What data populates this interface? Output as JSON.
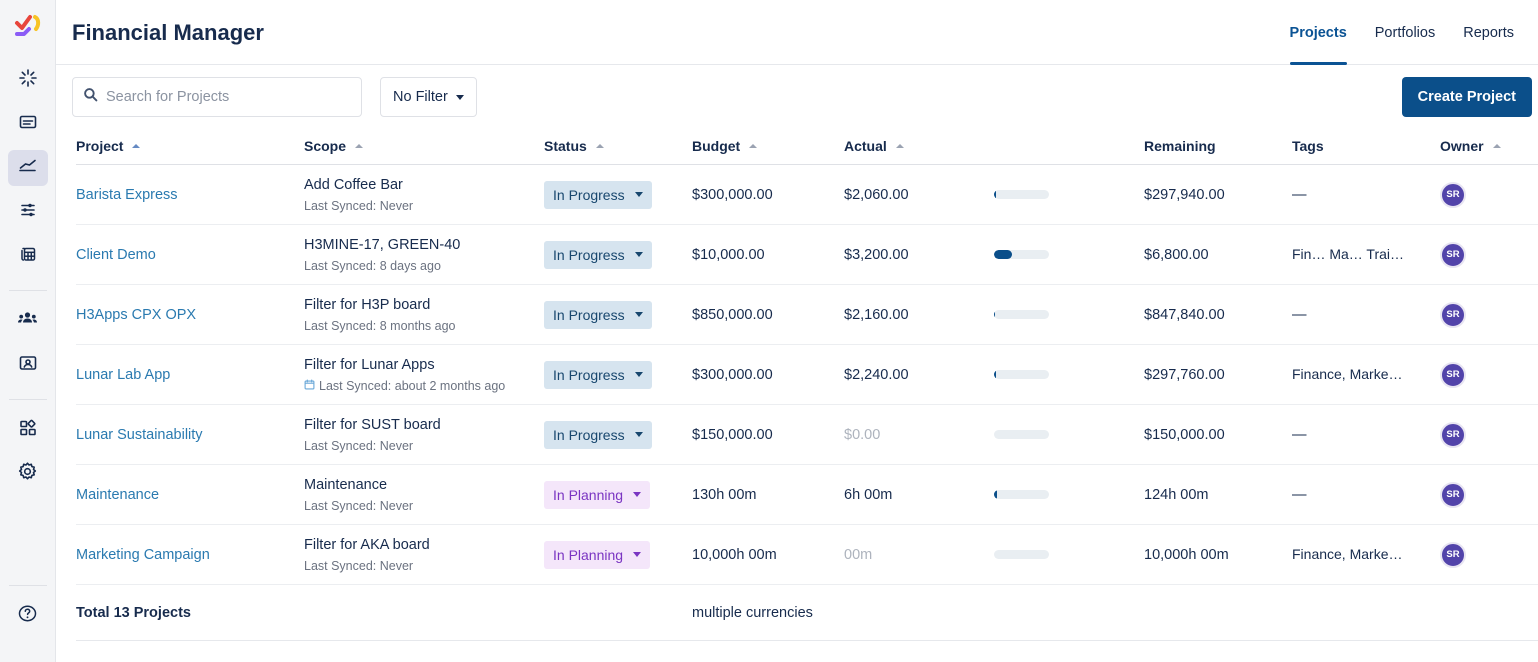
{
  "sidebar": {
    "logo": "app-logo",
    "items": [
      {
        "name": "sidebar-item-spark",
        "icon": "spark-icon"
      },
      {
        "name": "sidebar-item-board",
        "icon": "board-icon"
      },
      {
        "name": "sidebar-item-chart",
        "icon": "line-chart-icon",
        "active": true
      },
      {
        "name": "sidebar-item-filters",
        "icon": "sliders-icon"
      },
      {
        "name": "sidebar-item-reports",
        "icon": "calculator-icon"
      },
      {
        "name": "sidebar-item-teams",
        "icon": "people-icon"
      },
      {
        "name": "sidebar-item-contacts",
        "icon": "contact-card-icon"
      },
      {
        "name": "sidebar-item-apps",
        "icon": "apps-grid-icon"
      },
      {
        "name": "sidebar-item-settings",
        "icon": "gear-icon"
      },
      {
        "name": "sidebar-item-help",
        "icon": "help-circle-icon"
      }
    ]
  },
  "header": {
    "title": "Financial Manager",
    "nav": [
      {
        "label": "Projects",
        "active": true
      },
      {
        "label": "Portfolios",
        "active": false
      },
      {
        "label": "Reports",
        "active": false
      }
    ]
  },
  "toolbar": {
    "search_placeholder": "Search for Projects",
    "search_value": "",
    "search_icon": "search-icon",
    "filter_label": "No Filter",
    "create_label": "Create Project"
  },
  "table": {
    "columns": [
      {
        "label": "Project",
        "sortable": true,
        "sorted": true
      },
      {
        "label": "Scope",
        "sortable": true,
        "sorted": false
      },
      {
        "label": "Status",
        "sortable": true,
        "sorted": false
      },
      {
        "label": "Budget",
        "sortable": true,
        "sorted": false
      },
      {
        "label": "Actual",
        "sortable": true,
        "sorted": false
      },
      {
        "label": "Remaining",
        "sortable": false,
        "sorted": false
      },
      {
        "label": "Tags",
        "sortable": false,
        "sorted": false
      },
      {
        "label": "Owner",
        "sortable": true,
        "sorted": false
      }
    ],
    "rows": [
      {
        "project": "Barista Express",
        "scope_title": "Add Coffee Bar",
        "scope_sync": "Last Synced: Never",
        "scope_icon": null,
        "status": "In Progress",
        "status_kind": "progress",
        "budget": "$300,000.00",
        "actual": "$2,060.00",
        "actual_zero": false,
        "progress_pct": 3,
        "remaining": "$297,940.00",
        "tags": "—",
        "owner_initials": "SR"
      },
      {
        "project": "Client Demo",
        "scope_title": "H3MINE-17, GREEN-40",
        "scope_sync": "Last Synced: 8 days ago",
        "scope_icon": null,
        "status": "In Progress",
        "status_kind": "progress",
        "budget": "$10,000.00",
        "actual": "$3,200.00",
        "actual_zero": false,
        "progress_pct": 32,
        "remaining": "$6,800.00",
        "tags": "Fin…  Ma…  Trai…",
        "owner_initials": "SR"
      },
      {
        "project": "H3Apps CPX OPX",
        "scope_title": "Filter for H3P board",
        "scope_sync": "Last Synced: 8 months ago",
        "scope_icon": null,
        "status": "In Progress",
        "status_kind": "progress",
        "budget": "$850,000.00",
        "actual": "$2,160.00",
        "actual_zero": false,
        "progress_pct": 2,
        "remaining": "$847,840.00",
        "tags": "—",
        "owner_initials": "SR"
      },
      {
        "project": "Lunar Lab App",
        "scope_title": "Filter for Lunar Apps",
        "scope_sync": "Last Synced: about 2 months ago",
        "scope_icon": "calendar-icon",
        "status": "In Progress",
        "status_kind": "progress",
        "budget": "$300,000.00",
        "actual": "$2,240.00",
        "actual_zero": false,
        "progress_pct": 3,
        "remaining": "$297,760.00",
        "tags": "Finance, Marke…",
        "owner_initials": "SR"
      },
      {
        "project": "Lunar Sustainability",
        "scope_title": "Filter for SUST board",
        "scope_sync": "Last Synced: Never",
        "scope_icon": null,
        "status": "In Progress",
        "status_kind": "progress",
        "budget": "$150,000.00",
        "actual": "$0.00",
        "actual_zero": true,
        "progress_pct": 0,
        "remaining": "$150,000.00",
        "tags": "—",
        "owner_initials": "SR"
      },
      {
        "project": "Maintenance",
        "scope_title": "Maintenance",
        "scope_sync": "Last Synced: Never",
        "scope_icon": null,
        "status": "In Planning",
        "status_kind": "planning",
        "budget": "130h 00m",
        "actual": "6h 00m",
        "actual_zero": false,
        "progress_pct": 5,
        "remaining": "124h 00m",
        "tags": "—",
        "owner_initials": "SR"
      },
      {
        "project": "Marketing Campaign",
        "scope_title": "Filter for AKA board",
        "scope_sync": "Last Synced: Never",
        "scope_icon": null,
        "status": "In Planning",
        "status_kind": "planning",
        "budget": "10,000h 00m",
        "actual": "00m",
        "actual_zero": true,
        "progress_pct": 0,
        "remaining": "10,000h 00m",
        "tags": "Finance, Marke…",
        "owner_initials": "SR"
      }
    ],
    "total": {
      "label": "Total 13 Projects",
      "currency_note": "multiple currencies"
    }
  },
  "colors": {
    "accent": "#0b4f8a",
    "link": "#2a7ab0",
    "text": "#172b4d",
    "status_progress_bg": "#d6e4ef",
    "status_progress_fg": "#18476e",
    "status_planning_bg": "#f4e6fa",
    "status_planning_fg": "#7a35c2",
    "avatar_bg": "#5243aa",
    "bar_track": "#e9eef2"
  }
}
